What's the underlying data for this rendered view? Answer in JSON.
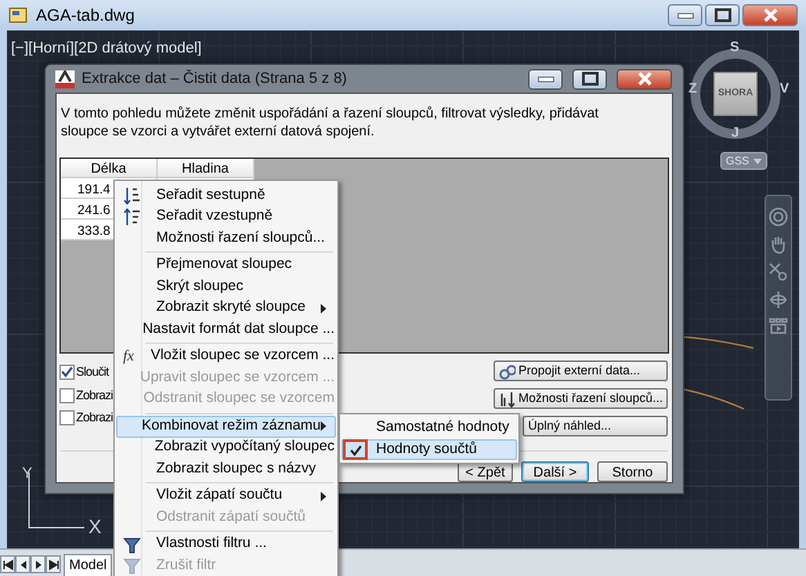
{
  "window": {
    "title": "AGA-tab.dwg"
  },
  "viewport_label": "[−][Horní][2D drátový model]",
  "view_cube": {
    "top_face": "SHORA",
    "north": "S",
    "east": "V",
    "south": "J",
    "west": "Z"
  },
  "ucs_menu": "GSS",
  "ucs_axes": {
    "y": "Y",
    "x": "X"
  },
  "layout_tabs": [
    {
      "label": "Model",
      "selected": true
    }
  ],
  "dialog": {
    "title": "Extrakce dat – Čistit data (Strana 5 z 8)",
    "description": "V tomto pohledu můžete změnit uspořádání a řazení sloupců, filtrovat výsledky, přidávat sloupce se vzorci a vytvářet externí datová spojení.",
    "table": {
      "columns": [
        "Délka",
        "Hladina"
      ],
      "rows": [
        [
          "191.4"
        ],
        [
          "241.6"
        ],
        [
          "333.8"
        ]
      ]
    },
    "options": [
      {
        "label": "Sloučit",
        "checked": true
      },
      {
        "label": "Zobrazi",
        "checked": false
      },
      {
        "label": "Zobrazi",
        "checked": false
      }
    ],
    "side_buttons": [
      {
        "label": "Propojit externí data..."
      },
      {
        "label": "Možnosti řazení sloupců..."
      },
      {
        "label": "Úplný náhled..."
      }
    ],
    "nav_buttons": [
      {
        "label": "< Zpět",
        "default": false
      },
      {
        "label": "Další >",
        "default": true
      },
      {
        "label": "Storno",
        "default": false
      }
    ]
  },
  "context_menu": {
    "groups": [
      [
        {
          "label": "Seřadit sestupně",
          "disabled": false,
          "submenu": false,
          "selected": false
        },
        {
          "label": "Seřadit vzestupně",
          "disabled": false,
          "submenu": false,
          "selected": false
        },
        {
          "label": "Možnosti řazení sloupců...",
          "disabled": false,
          "submenu": false,
          "selected": false
        }
      ],
      [
        {
          "label": "Přejmenovat sloupec",
          "disabled": false,
          "submenu": false,
          "selected": false
        },
        {
          "label": "Skrýt sloupec",
          "disabled": false,
          "submenu": false,
          "selected": false
        },
        {
          "label": "Zobrazit skryté sloupce",
          "disabled": false,
          "submenu": true,
          "selected": false
        },
        {
          "label": "Nastavit formát dat sloupce ...",
          "disabled": false,
          "submenu": false,
          "selected": false
        }
      ],
      [
        {
          "label": "Vložit sloupec se vzorcem ...",
          "icon_text": "fx",
          "disabled": false,
          "submenu": false,
          "selected": false
        },
        {
          "label": "Upravit sloupec se vzorcem ...",
          "disabled": true,
          "submenu": false,
          "selected": false
        },
        {
          "label": "Odstranit sloupec se vzorcem",
          "disabled": true,
          "submenu": false,
          "selected": false
        }
      ],
      [
        {
          "label": "Kombinovat režim záznamu",
          "disabled": false,
          "submenu": true,
          "selected": true
        },
        {
          "label": "Zobrazit vypočítaný sloupec",
          "disabled": false,
          "submenu": false,
          "selected": false
        },
        {
          "label": "Zobrazit sloupec s názvy",
          "disabled": false,
          "submenu": false,
          "selected": false
        }
      ],
      [
        {
          "label": "Vložit zápatí součtu",
          "disabled": false,
          "submenu": true,
          "selected": false
        },
        {
          "label": "Odstranit zápatí součtů",
          "disabled": true,
          "submenu": false,
          "selected": false
        }
      ],
      [
        {
          "label": "Vlastnosti filtru ...",
          "disabled": false,
          "submenu": false,
          "selected": false
        },
        {
          "label": "Zrušit filtr",
          "disabled": true,
          "submenu": false,
          "selected": false
        }
      ]
    ]
  },
  "submenu": {
    "items": [
      {
        "label": "Samostatné hodnoty",
        "checked": false,
        "selected": false
      },
      {
        "label": "Hodnoty součtů",
        "checked": true,
        "selected": true
      }
    ]
  }
}
